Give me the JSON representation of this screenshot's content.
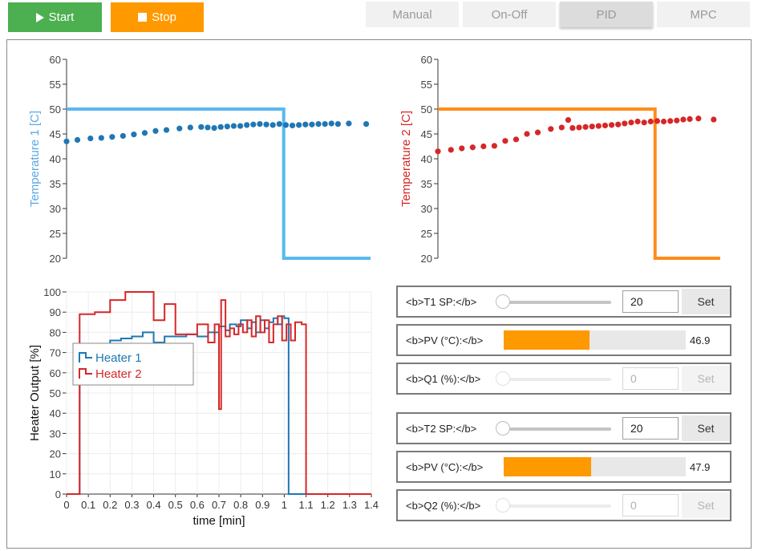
{
  "toolbar": {
    "start_label": "Start",
    "stop_label": "Stop",
    "start_color": "#4caf50",
    "stop_color": "#fe9900"
  },
  "tabs": [
    {
      "label": "Manual",
      "active": false
    },
    {
      "label": "On-Off",
      "active": false
    },
    {
      "label": "PID",
      "active": true
    },
    {
      "label": "MPC",
      "active": false
    }
  ],
  "chart_data": [
    {
      "type": "line",
      "id": "t1",
      "ylabel": "Temperature 1 [C]",
      "ylabel_color": "#5aa9e6",
      "ylim": [
        20,
        60
      ],
      "yticks": [
        20,
        25,
        30,
        35,
        40,
        45,
        50,
        55,
        60
      ],
      "xlim": [
        0,
        1.4
      ],
      "series": [
        {
          "kind": "setpoint",
          "color": "#5ab8f0",
          "x": [
            0.0,
            1.0,
            1.0,
            1.4
          ],
          "y": [
            50,
            50,
            20,
            20
          ]
        },
        {
          "kind": "measured",
          "color": "#1f77b4",
          "x": [
            0.0,
            0.05,
            0.11,
            0.16,
            0.21,
            0.26,
            0.31,
            0.36,
            0.41,
            0.46,
            0.52,
            0.57,
            0.62,
            0.65,
            0.68,
            0.71,
            0.74,
            0.77,
            0.8,
            0.83,
            0.86,
            0.89,
            0.92,
            0.95,
            0.98,
            1.01,
            1.04,
            1.07,
            1.1,
            1.13,
            1.16,
            1.19,
            1.22,
            1.25,
            1.3,
            1.38
          ],
          "y": [
            43.5,
            43.8,
            44.1,
            44.2,
            44.4,
            44.6,
            44.9,
            45.2,
            45.6,
            45.8,
            46.1,
            46.3,
            46.4,
            46.3,
            46.2,
            46.4,
            46.5,
            46.6,
            46.6,
            46.8,
            46.9,
            47.0,
            46.9,
            46.8,
            47.0,
            46.8,
            46.7,
            46.8,
            46.9,
            46.9,
            47.0,
            47.0,
            47.1,
            47.0,
            47.1,
            47.0
          ]
        }
      ]
    },
    {
      "type": "line",
      "id": "t2",
      "ylabel": "Temperature 2 [C]",
      "ylabel_color": "#d62728",
      "ylim": [
        20,
        60
      ],
      "yticks": [
        20,
        25,
        30,
        35,
        40,
        45,
        50,
        55,
        60
      ],
      "xlim": [
        0,
        1.4
      ],
      "series": [
        {
          "kind": "setpoint",
          "color": "#fe8c1a",
          "x": [
            0.0,
            1.0,
            1.0,
            1.3
          ],
          "y": [
            50,
            50,
            20,
            20
          ]
        },
        {
          "kind": "measured",
          "color": "#d62728",
          "x": [
            0.0,
            0.06,
            0.11,
            0.16,
            0.21,
            0.26,
            0.31,
            0.36,
            0.41,
            0.46,
            0.52,
            0.57,
            0.6,
            0.62,
            0.65,
            0.68,
            0.71,
            0.74,
            0.77,
            0.8,
            0.83,
            0.86,
            0.89,
            0.92,
            0.95,
            0.98,
            1.01,
            1.04,
            1.07,
            1.1,
            1.13,
            1.16,
            1.2,
            1.27
          ],
          "y": [
            41.5,
            41.8,
            42.1,
            42.3,
            42.5,
            42.6,
            43.6,
            43.9,
            45.0,
            45.3,
            46.0,
            46.3,
            47.8,
            46.2,
            46.3,
            46.4,
            46.5,
            46.6,
            46.7,
            46.8,
            46.9,
            47.1,
            47.3,
            47.5,
            47.3,
            47.5,
            47.6,
            47.5,
            47.6,
            47.7,
            47.9,
            48.0,
            48.1,
            47.9
          ]
        }
      ]
    },
    {
      "type": "line",
      "id": "heaters",
      "ylabel": "Heater Output [%]",
      "xlabel": "time [min]",
      "ylim": [
        0,
        100
      ],
      "yticks": [
        0,
        10,
        20,
        30,
        40,
        50,
        60,
        70,
        80,
        90,
        100
      ],
      "xlim": [
        0,
        1.4
      ],
      "xticks": [
        0,
        0.1,
        0.2,
        0.3,
        0.4,
        0.5,
        0.6,
        0.7,
        0.8,
        0.9,
        1,
        1.1,
        1.2,
        1.3,
        1.4
      ],
      "legend": {
        "position": "left",
        "entries": [
          "Heater 1",
          "Heater 2"
        ]
      },
      "series": [
        {
          "name": "Heater 1",
          "color": "#1f77b4",
          "step": true,
          "x": [
            0.0,
            0.06,
            0.09,
            0.12,
            0.15,
            0.2,
            0.25,
            0.3,
            0.35,
            0.4,
            0.45,
            0.5,
            0.55,
            0.6,
            0.65,
            0.7,
            0.73,
            0.75,
            0.78,
            0.8,
            0.83,
            0.85,
            0.87,
            0.89,
            0.91,
            0.93,
            0.95,
            0.97,
            0.99,
            1.0,
            1.02,
            1.1,
            1.4
          ],
          "y": [
            0,
            72,
            70,
            70,
            73,
            76,
            77,
            78,
            80,
            75,
            78,
            78,
            79,
            78,
            80,
            83,
            81,
            84,
            83,
            86,
            82,
            85,
            80,
            86,
            82,
            85,
            87,
            84,
            88,
            87,
            0,
            0,
            0
          ]
        },
        {
          "name": "Heater 2",
          "color": "#d62728",
          "step": true,
          "x": [
            0.0,
            0.06,
            0.13,
            0.2,
            0.27,
            0.3,
            0.36,
            0.4,
            0.45,
            0.5,
            0.55,
            0.6,
            0.65,
            0.68,
            0.7,
            0.71,
            0.73,
            0.75,
            0.77,
            0.79,
            0.81,
            0.83,
            0.85,
            0.87,
            0.89,
            0.91,
            0.93,
            0.95,
            0.97,
            0.99,
            1.01,
            1.03,
            1.05,
            1.08,
            1.1,
            1.4
          ],
          "y": [
            0,
            89,
            90,
            96,
            100,
            100,
            100,
            86,
            94,
            79,
            79,
            84,
            75,
            84,
            42,
            96,
            78,
            82,
            79,
            84,
            80,
            86,
            78,
            88,
            80,
            86,
            75,
            84,
            88,
            76,
            84,
            76,
            85,
            84,
            0,
            0
          ]
        }
      ]
    }
  ],
  "controls": {
    "t1": {
      "sp_label": "<b>T1 SP:</b>",
      "sp_value": "20",
      "set_label": "Set",
      "pv_label": "<b>PV (°C):</b>",
      "pv_value": "46.9",
      "pv_fraction": 0.47,
      "q_label": "<b>Q1 (%):</b>",
      "q_value": "0",
      "q_set_label": "Set"
    },
    "t2": {
      "sp_label": "<b>T2 SP:</b>",
      "sp_value": "20",
      "set_label": "Set",
      "pv_label": "<b>PV (°C):</b>",
      "pv_value": "47.9",
      "pv_fraction": 0.48,
      "q_label": "<b>Q2 (%):</b>",
      "q_value": "0",
      "q_set_label": "Set"
    },
    "pv_fill_color": "#fe9900"
  }
}
